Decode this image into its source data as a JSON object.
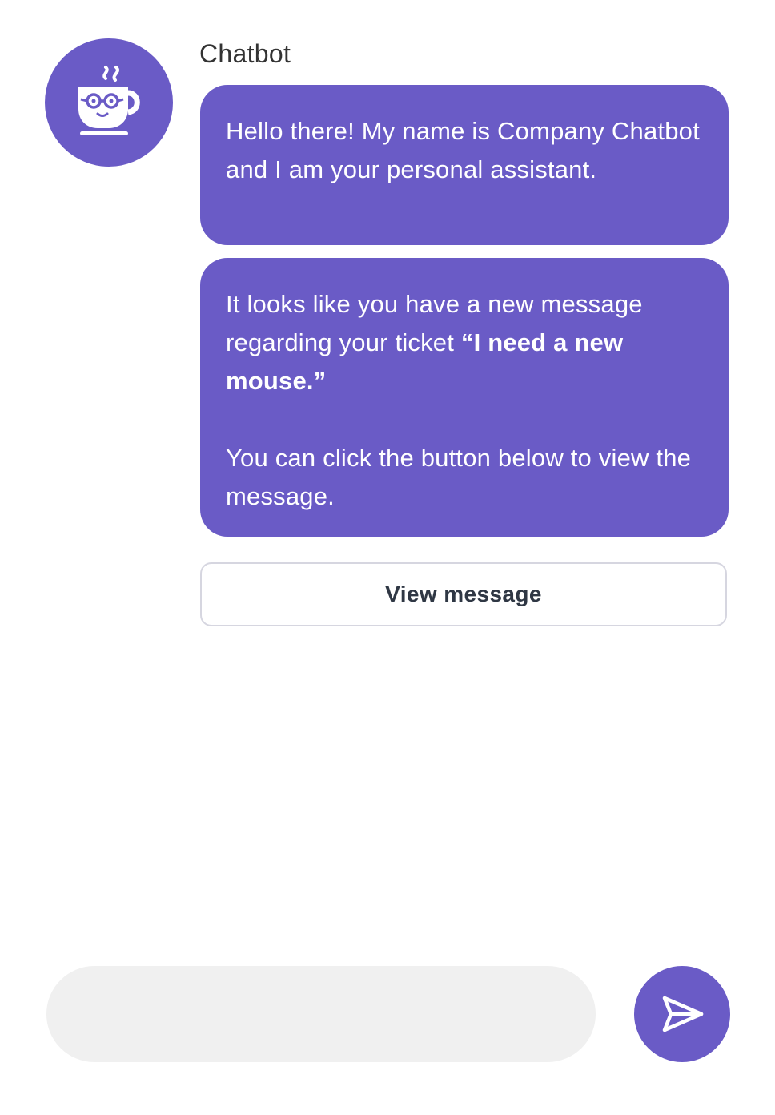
{
  "chat": {
    "sender_name": "Chatbot",
    "avatar_icon": "coffee-cup-with-glasses-icon",
    "accent_color": "#6a5bc6",
    "messages": [
      {
        "text": "Hello there! My name is Company Chatbot and I am your personal assistant."
      },
      {
        "text_before": "It looks like you have a new message regarding your ticket ",
        "text_bold": "“I need a new mouse.”",
        "text_after": "You can click the button below to view the message."
      }
    ],
    "action_button_label": "View message"
  },
  "composer": {
    "input_value": "",
    "input_placeholder": "",
    "send_icon": "send-arrow-icon"
  }
}
